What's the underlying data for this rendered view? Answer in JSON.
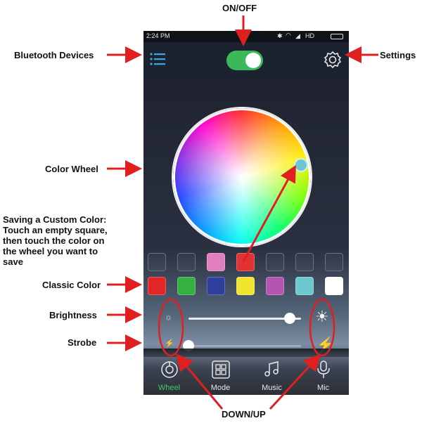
{
  "annotations": {
    "on_off": "ON/OFF",
    "bluetooth_devices": "Bluetooth Devices",
    "settings": "Settings",
    "color_wheel": "Color Wheel",
    "saving_custom": "Saving a Custom Color:\nTouch an empty square,\nthen touch the color on\nthe wheel you want to\nsave",
    "classic_color": "Classic Color",
    "brightness": "Brightness",
    "strobe": "Strobe",
    "down_up": "DOWN/UP"
  },
  "status_bar": {
    "time": "2:24 PM",
    "network": "HD"
  },
  "toggle": {
    "on": true
  },
  "icons": {
    "menu": "menu-icon",
    "settings": "gear-icon",
    "brightness_low": "sun-small-icon",
    "brightness_high": "sun-large-icon",
    "strobe_low": "lightning-small-icon",
    "strobe_high": "lightning-large-icon"
  },
  "custom_colors": [
    "",
    "",
    "#e07fbf",
    "#e03434",
    "",
    "",
    ""
  ],
  "classic_colors": [
    "#e02626",
    "#37b043",
    "#2e3f9e",
    "#f1e530",
    "#b456b0",
    "#6cc9cf",
    "#ffffff"
  ],
  "sliders": {
    "brightness": 0.9,
    "strobe": 0.0
  },
  "nav": [
    {
      "label": "Wheel",
      "icon": "wheel-icon",
      "active": true
    },
    {
      "label": "Mode",
      "icon": "grid-icon",
      "active": false
    },
    {
      "label": "Music",
      "icon": "music-note-icon",
      "active": false
    },
    {
      "label": "Mic",
      "icon": "microphone-icon",
      "active": false
    }
  ],
  "colors": {
    "annotation_red": "#e02020",
    "toggle_green": "#3bb95a",
    "accent_blue": "#3aa8e0",
    "active_nav": "#3bd16b"
  }
}
